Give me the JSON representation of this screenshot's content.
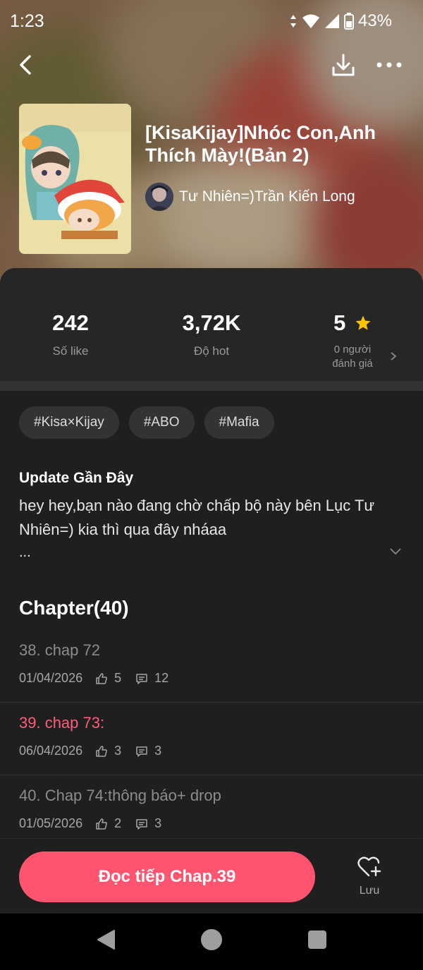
{
  "status_bar": {
    "time": "1:23",
    "battery_percent": "43%"
  },
  "story": {
    "title": "[KisaKijay]Nhóc Con,Anh Thích Mày!(Bản 2)",
    "author": "Tư Nhiên=)Trần Kiến Long"
  },
  "stats": {
    "likes_value": "242",
    "likes_label": "Số like",
    "hot_value": "3,72K",
    "hot_label": "Độ hot",
    "rating_value": "5",
    "rating_label_line1": "0 người",
    "rating_label_line2": "đánh giá"
  },
  "tags": [
    "#Kisa×Kijay",
    "#ABO",
    "#Mafia"
  ],
  "update": {
    "heading": "Update Gần Đây",
    "text": "hey hey,bạn nào đang chờ chấp bộ này bên Lục Tư Nhiên=) kia thì qua đây nháaa",
    "ellipsis": "..."
  },
  "chapters": {
    "heading": "Chapter(40)",
    "items": [
      {
        "title": "38. chap 72",
        "date": "01/04/2026",
        "likes": "5",
        "comments": "12",
        "current": false
      },
      {
        "title": "39. chap 73:",
        "date": "06/04/2026",
        "likes": "3",
        "comments": "3",
        "current": true
      },
      {
        "title": "40. Chap 74:thông báo+ drop",
        "date": "01/05/2026",
        "likes": "2",
        "comments": "3",
        "current": false
      }
    ]
  },
  "actions": {
    "read_button": "Đọc tiếp Chap.39",
    "save_label": "Lưu"
  },
  "colors": {
    "accent": "#ff5470",
    "current_chapter": "#ff5c7a",
    "star": "#ffc400"
  }
}
